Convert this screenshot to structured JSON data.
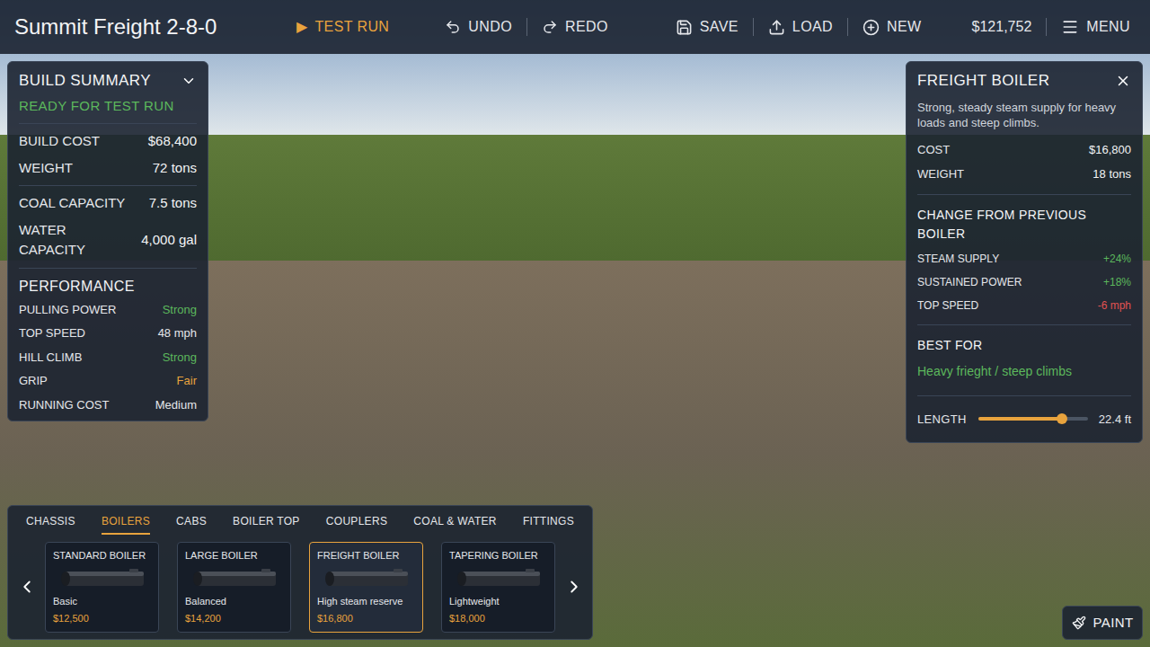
{
  "top_bar": {
    "title": "Summit Freight 2-8-0",
    "test_run": {
      "icon": "▶",
      "label": "TEST RUN"
    },
    "history": [
      {
        "label": "UNDO"
      },
      {
        "label": "REDO"
      }
    ],
    "file": [
      {
        "label": "SAVE"
      },
      {
        "label": "LOAD"
      },
      {
        "label": "NEW"
      }
    ],
    "money": "$121,752",
    "menu": "MENU"
  },
  "build_summary": {
    "title": "BUILD SUMMARY",
    "expanded": true,
    "status": "READY FOR TEST RUN",
    "cost_rows": [
      {
        "label": "BUILD COST",
        "value": "$68,400"
      },
      {
        "label": "WEIGHT",
        "value": "72 tons"
      }
    ],
    "capacity_rows": [
      {
        "label": "COAL CAPACITY",
        "value": "7.5 tons"
      },
      {
        "label": "WATER CAPACITY",
        "value": "4,000 gal"
      }
    ],
    "performance_title": "PERFORMANCE",
    "performance": [
      {
        "label": "PULLING POWER",
        "value": "Strong",
        "color": "#5cb85c"
      },
      {
        "label": "TOP SPEED",
        "value": "48 mph",
        "color": "#e5e7eb"
      },
      {
        "label": "HILL CLIMB",
        "value": "Strong",
        "color": "#5cb85c"
      },
      {
        "label": "GRIP",
        "value": "Fair",
        "color": "#e8a33d"
      },
      {
        "label": "RUNNING COST",
        "value": "Medium",
        "color": "#e5e7eb"
      }
    ]
  },
  "part_details": {
    "title": "FREIGHT BOILER",
    "description": "Strong, steady steam supply for heavy loads and steep climbs.",
    "stats": [
      {
        "label": "COST",
        "value": "$16,800"
      },
      {
        "label": "WEIGHT",
        "value": "18 tons"
      }
    ],
    "change_title": "CHANGE FROM PREVIOUS BOILER",
    "changes": [
      {
        "label": "STEAM SUPPLY",
        "value": "+24%",
        "color": "#5cb85c"
      },
      {
        "label": "SUSTAINED POWER",
        "value": "+18%",
        "color": "#5cb85c"
      },
      {
        "label": "TOP SPEED",
        "value": "-6 mph",
        "color": "#e05252"
      }
    ],
    "best_for_title": "BEST FOR",
    "best_for": "Heavy frieght / steep climbs",
    "length": {
      "label": "LENGTH",
      "level": 0.76,
      "reading": "22.4 ft"
    }
  },
  "part_picker": {
    "tabs": [
      {
        "label": "CHASSIS",
        "selected": false
      },
      {
        "label": "BOILERS",
        "selected": true
      },
      {
        "label": "CABS",
        "selected": false
      },
      {
        "label": "BOILER TOP",
        "selected": false
      },
      {
        "label": "COUPLERS",
        "selected": false
      },
      {
        "label": "COAL & WATER",
        "selected": false
      },
      {
        "label": "FITTINGS",
        "selected": false
      }
    ],
    "cards": [
      {
        "name": "STANDARD BOILER",
        "subtitle": "Basic",
        "price": "$12,500",
        "selected": false
      },
      {
        "name": "LARGE BOILER",
        "subtitle": "Balanced",
        "price": "$14,200",
        "selected": false
      },
      {
        "name": "FREIGHT BOILER",
        "subtitle": "High steam reserve",
        "price": "$16,800",
        "selected": true
      },
      {
        "name": "TAPERING BOILER",
        "subtitle": "Lightweight",
        "price": "$18,000",
        "selected": false
      }
    ]
  },
  "paint_button": {
    "label": "PAINT"
  }
}
